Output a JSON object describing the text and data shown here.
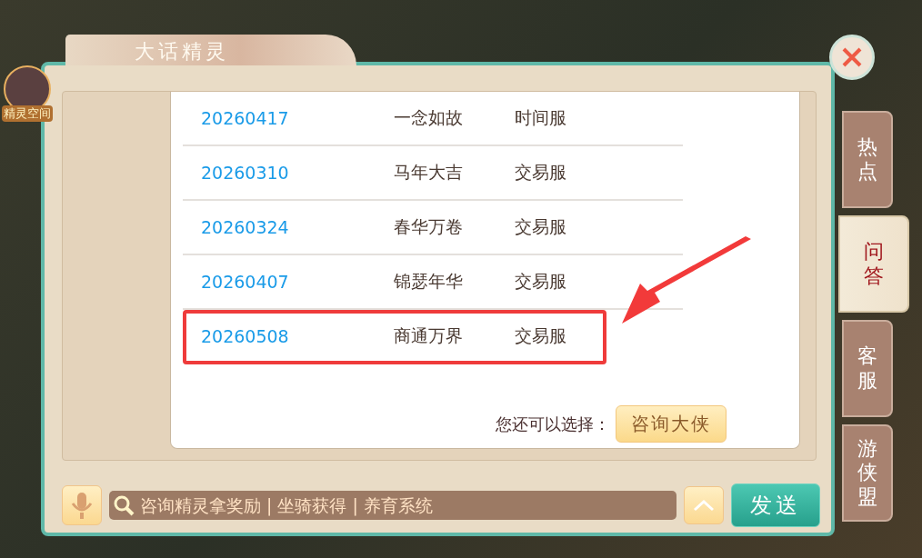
{
  "window": {
    "title": "大话精灵"
  },
  "avatar": {
    "label": "精灵空间"
  },
  "rows": [
    {
      "date": "20260417",
      "name": "一念如故",
      "server": "时间服",
      "highlighted": false
    },
    {
      "date": "20260310",
      "name": "马年大吉",
      "server": "交易服",
      "highlighted": false
    },
    {
      "date": "20260324",
      "name": "春华万卷",
      "server": "交易服",
      "highlighted": false
    },
    {
      "date": "20260407",
      "name": "锦瑟年华",
      "server": "交易服",
      "highlighted": false
    },
    {
      "date": "20260508",
      "name": "商通万界",
      "server": "交易服",
      "highlighted": true
    }
  ],
  "footer": {
    "prompt": "您还可以选择：",
    "button": "咨询大侠"
  },
  "side_tabs": [
    {
      "label": "热点",
      "selected": false
    },
    {
      "label": "问答",
      "selected": true
    },
    {
      "label": "客服",
      "selected": false
    },
    {
      "label": "游侠盟",
      "selected": false
    }
  ],
  "input": {
    "placeholder": "咨询精灵拿奖励 | 坐骑获得 | 养育系统"
  },
  "send_button": "发送"
}
